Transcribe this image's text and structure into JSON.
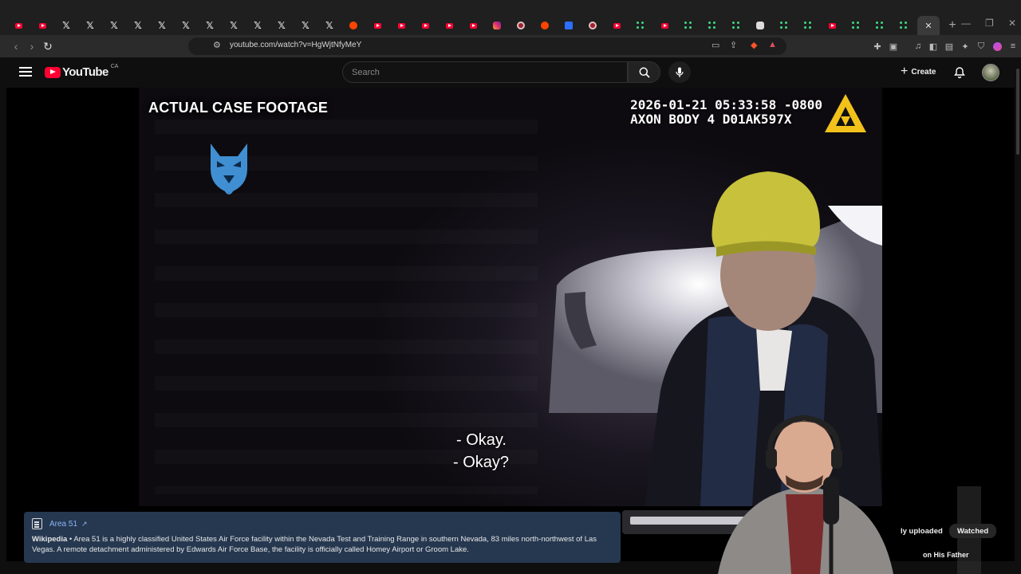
{
  "browser": {
    "tabs": [
      {
        "icon": "youtube"
      },
      {
        "icon": "youtube"
      },
      {
        "icon": "x"
      },
      {
        "icon": "x"
      },
      {
        "icon": "x"
      },
      {
        "icon": "x"
      },
      {
        "icon": "x"
      },
      {
        "icon": "x"
      },
      {
        "icon": "x"
      },
      {
        "icon": "x"
      },
      {
        "icon": "x"
      },
      {
        "icon": "x"
      },
      {
        "icon": "x"
      },
      {
        "icon": "x"
      },
      {
        "icon": "reddit"
      },
      {
        "icon": "youtube"
      },
      {
        "icon": "youtube"
      },
      {
        "icon": "youtube"
      },
      {
        "icon": "youtube"
      },
      {
        "icon": "youtube"
      },
      {
        "icon": "instagram"
      },
      {
        "icon": "circle"
      },
      {
        "icon": "reddit"
      },
      {
        "icon": "blue"
      },
      {
        "icon": "circle"
      },
      {
        "icon": "youtube"
      },
      {
        "icon": "dots"
      },
      {
        "icon": "youtube"
      },
      {
        "icon": "dots"
      },
      {
        "icon": "dots"
      },
      {
        "icon": "dots"
      },
      {
        "icon": "square"
      },
      {
        "icon": "dots"
      },
      {
        "icon": "dots"
      },
      {
        "icon": "youtube"
      },
      {
        "icon": "dots"
      },
      {
        "icon": "dots"
      },
      {
        "icon": "dots"
      }
    ],
    "url": "youtube.com/watch?v=HgWjtNfyMeY"
  },
  "youtube": {
    "logo_text": "YouTube",
    "country_code": "CA",
    "search_placeholder": "Search",
    "create_label": "Create"
  },
  "video": {
    "overlay_label": "ACTUAL CASE FOOTAGE",
    "timestamp": "2026-01-21 05:33:58 -0800",
    "device_id": "AXON BODY 4 D01AK597X",
    "subtitle_line1": "- Okay.",
    "subtitle_line2": "- Okay?"
  },
  "info_card": {
    "title": "Area 51",
    "source": "Wikipedia",
    "text": " • Area 51 is a highly classified United States Air Force facility within the Nevada Test and Training Range in southern Nevada, 83 miles north-northwest of Las Vegas. A remote detachment administered by Edwards Air Force Base, the facility is officially called Homey Airport or Groom Lake."
  },
  "chips": {
    "recently_uploaded_partial": "ly uploaded",
    "watched": "Watched",
    "video_title_partial": "on His Father"
  },
  "colors": {
    "youtube_red": "#ff0033",
    "card_bg": "#263850",
    "link": "#8ab4f8"
  }
}
